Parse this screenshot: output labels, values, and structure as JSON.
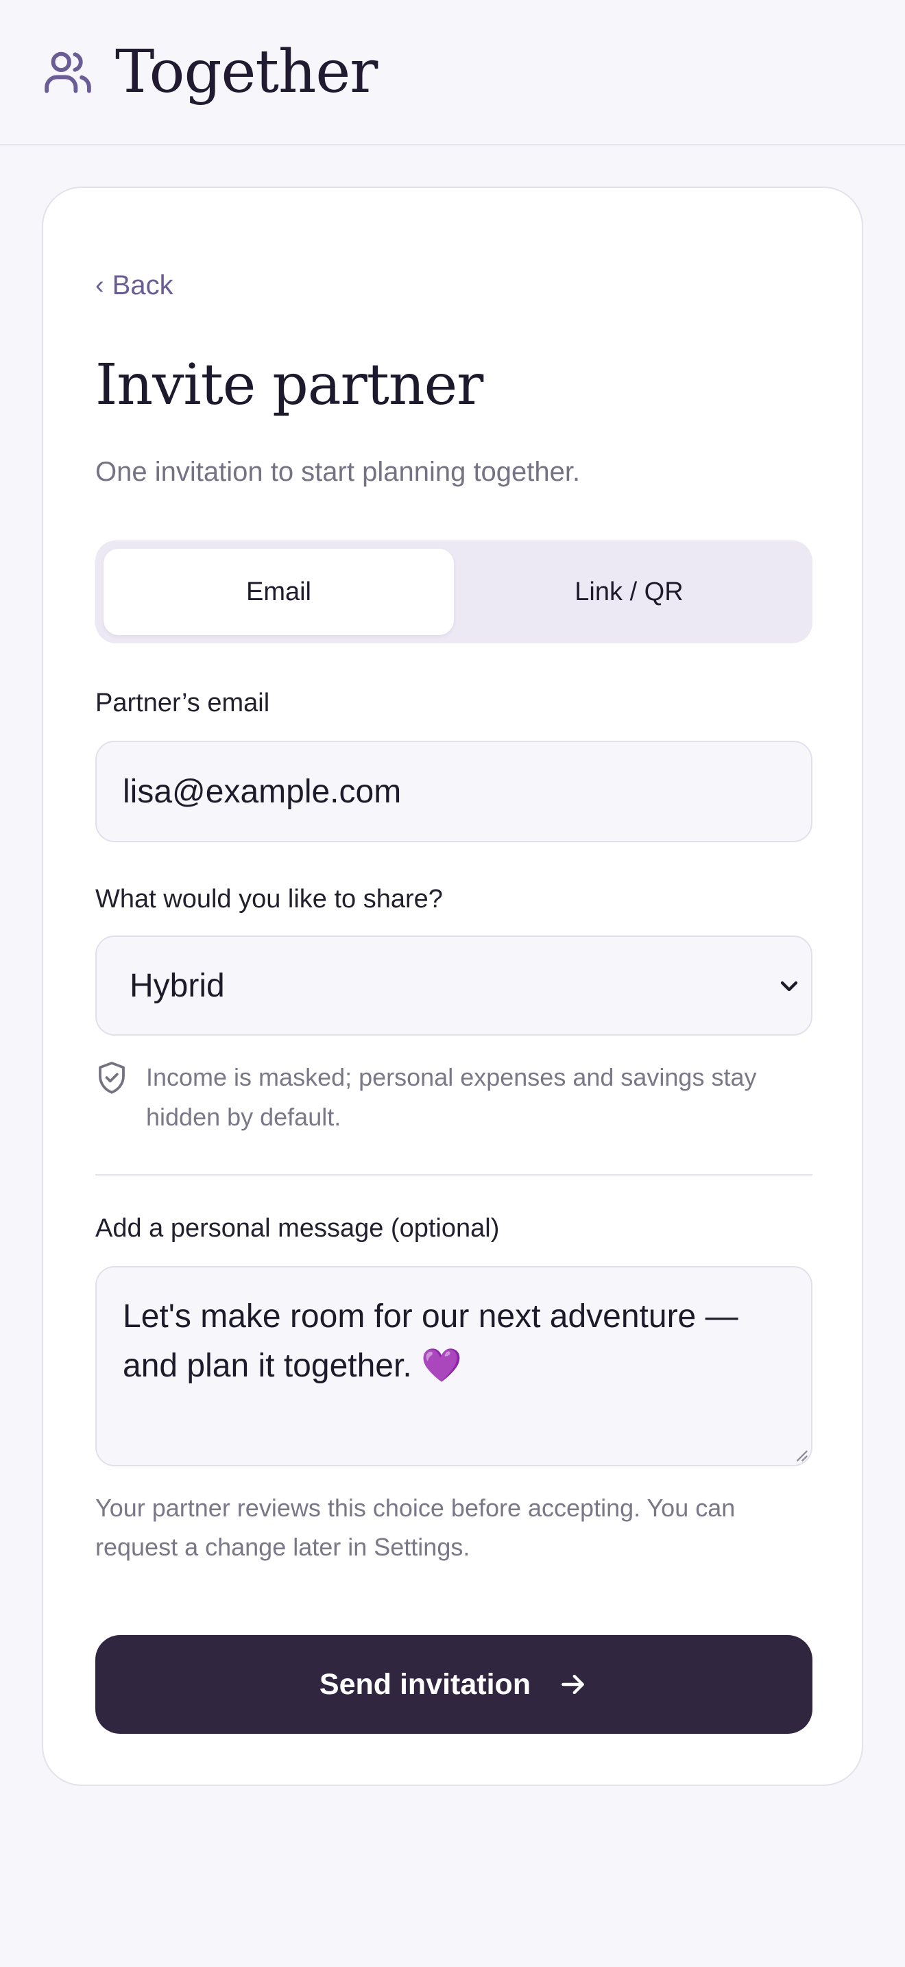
{
  "app": {
    "title": "Together",
    "icon": "users-icon"
  },
  "nav": {
    "back_label": "Back"
  },
  "page": {
    "title": "Invite partner",
    "subtitle": "One invitation to start planning together."
  },
  "tabs": [
    {
      "label": "Email",
      "active": true
    },
    {
      "label": "Link / QR",
      "active": false
    }
  ],
  "form": {
    "email_label": "Partner’s email",
    "email_value": "lisa@example.com",
    "share_label": "What would you like to share?",
    "share_value": "Hybrid",
    "share_hint": "Income is masked; personal expenses and savings stay hidden by default.",
    "message_label": "Add a personal message (optional)",
    "message_value": "Let's make room for our next adventure — and plan it together. 💜",
    "note": "Your partner reviews this choice before accepting. You can request a change later in Settings."
  },
  "actions": {
    "send_label": "Send invitation"
  },
  "colors": {
    "accent": "#6a5c94",
    "primary_button": "#31263f",
    "background": "#f7f6fb"
  }
}
